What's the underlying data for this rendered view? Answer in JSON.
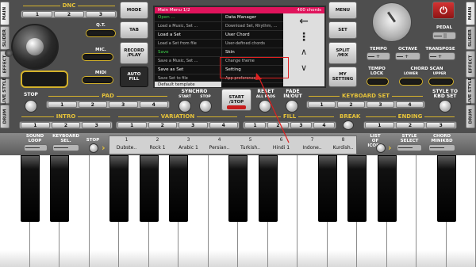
{
  "side_tabs_left": [
    "MAIN",
    "SLIDER",
    "EFFECT",
    "LIVE STYLE",
    "DRUM"
  ],
  "side_tabs_right": [
    "MAIN",
    "SLIDER",
    "EFFECT",
    "LIVE STYLE",
    "DRUM"
  ],
  "dnc": {
    "title": "DNC",
    "buttons": [
      "1",
      "2",
      "3"
    ],
    "qt": "Q.T.",
    "mic": "MIC.",
    "midi": "MIDI"
  },
  "mid_left_buttons": {
    "mode": "MODE",
    "tab": "TAB",
    "record": "RECORD\n/PLAY",
    "autofill": "AUTO\nFILL"
  },
  "menu": {
    "header_left": "Main Menu  1/2",
    "header_right": "400 chords",
    "left_items": [
      "Open ...",
      "Load a Music, Set ...",
      "Load a Set",
      "Load a Set from file",
      "Save",
      "Save a Music, Set ...",
      "Save as Set",
      "Save Set to file",
      "Default template"
    ],
    "right_items": [
      "Data Manager",
      "Download Set, Rhythm, ...",
      "User Chord",
      "User-defined chords",
      "Skin",
      "Change theme",
      "Setting",
      "App preferences"
    ],
    "nav": {
      "back": "←",
      "more": "⋮",
      "up": "∧",
      "down": "∨"
    }
  },
  "right_top_buttons": {
    "menu": "MENU",
    "set": "SET",
    "split": "SPLIT\n/MIX",
    "mysetting": "MY\nSETTING"
  },
  "top_right": {
    "pedal": "PEDAL",
    "tempo": "TEMPO",
    "octave": "OCTAVE",
    "transpose": "TRANSPOSE",
    "tempo_lock": "TEMPO\nLOCK",
    "chord_scan": "CHORD SCAN",
    "lower": "LOWER",
    "upper": "UPPER"
  },
  "pad": {
    "stop": "STOP",
    "title": "PAD",
    "buttons": [
      "1",
      "2",
      "3",
      "4"
    ]
  },
  "synchro": {
    "title": "SYNCHRO",
    "start": "START",
    "stop": "STOP"
  },
  "start_stop": "START\n/STOP",
  "reset": {
    "title": "RESET",
    "sub": "ALL PADS"
  },
  "fade": "FADE\nIN/OUT",
  "keyboard_set": {
    "title": "KEYBOARD SET",
    "buttons": [
      "1",
      "2",
      "3",
      "4"
    ],
    "style_to": "STYLE TO\nKBD SET"
  },
  "intro": {
    "title": "INTRO",
    "buttons": [
      "1",
      "2",
      "3"
    ]
  },
  "variation": {
    "title": "VARIATION",
    "buttons": [
      "1",
      "2",
      "3",
      "4"
    ]
  },
  "fill": {
    "title": "FILL",
    "buttons": [
      "1",
      "2",
      "3",
      "4"
    ]
  },
  "break": {
    "title": "BREAK"
  },
  "ending": {
    "title": "ENDING",
    "buttons": [
      "1",
      "2",
      "3"
    ]
  },
  "bottom_bar": {
    "sound_loop": "SOUND\nLOOP",
    "keyboard_sel": "KEYBOARD\nSEL.",
    "stop": "STOP",
    "list_of_icons": "LIST\nOF ICONS",
    "style_select": "STYLE\nSELECT",
    "chord_minikbd": "CHORD\nMINIKBD"
  },
  "styles": [
    {
      "n": "1",
      "name": "Dubste.."
    },
    {
      "n": "2",
      "name": "Rock 1"
    },
    {
      "n": "3",
      "name": "Arabic 1"
    },
    {
      "n": "4",
      "name": "Persian.."
    },
    {
      "n": "5",
      "name": "Turkish.."
    },
    {
      "n": "6",
      "name": "Hindi 1"
    },
    {
      "n": "7",
      "name": "Indone.."
    },
    {
      "n": "8",
      "name": "Kurdish.."
    }
  ],
  "colors": {
    "accent": "#e5c23a",
    "menu_header": "#e0145c",
    "highlight_box": "#e02020",
    "menu_green": "#3ed14a"
  }
}
